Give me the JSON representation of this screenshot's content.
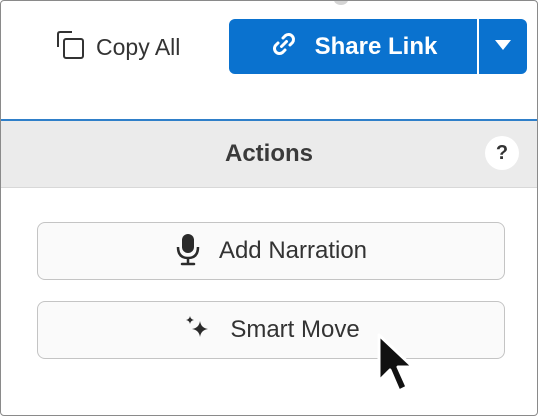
{
  "toolbar": {
    "copy_all_label": "Copy All",
    "share_link_label": "Share Link"
  },
  "actions": {
    "title": "Actions",
    "help_label": "?",
    "buttons": [
      {
        "label": "Add Narration",
        "icon": "microphone-icon"
      },
      {
        "label": "Smart Move",
        "icon": "sparkles-icon"
      }
    ]
  },
  "colors": {
    "accent": "#0a72cf",
    "divider": "#2f7fc9",
    "header_bg": "#ebebeb"
  }
}
